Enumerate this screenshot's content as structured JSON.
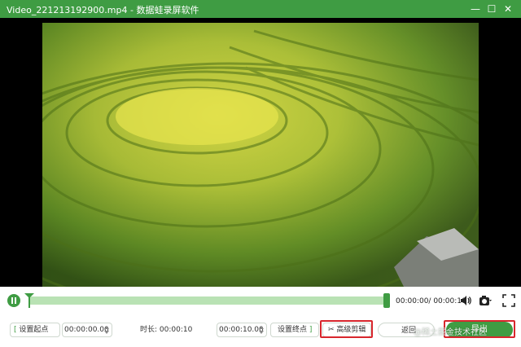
{
  "window": {
    "title": "Video_221213192900.mp4 - 数据蛙录屏软件",
    "accent": "#3f9c43"
  },
  "playback": {
    "time_display": "00:00:00/ 00:00:10",
    "progress": 0.0
  },
  "trim": {
    "set_start_label": "设置起点",
    "start_value": "00:00:00.00",
    "duration_label": "时长: 00:00:10",
    "end_value": "00:00:10.00",
    "set_end_label": "设置终点",
    "advanced_edit_label": "高级剪辑",
    "back_label": "返回",
    "export_label": "导出"
  },
  "watermark": "@稀土掘金技术社区",
  "icons": {
    "pause": "pause-icon",
    "volume": "volume-icon",
    "camera": "camera-icon",
    "fullscreen": "fullscreen-icon",
    "scissors": "scissors-icon"
  }
}
